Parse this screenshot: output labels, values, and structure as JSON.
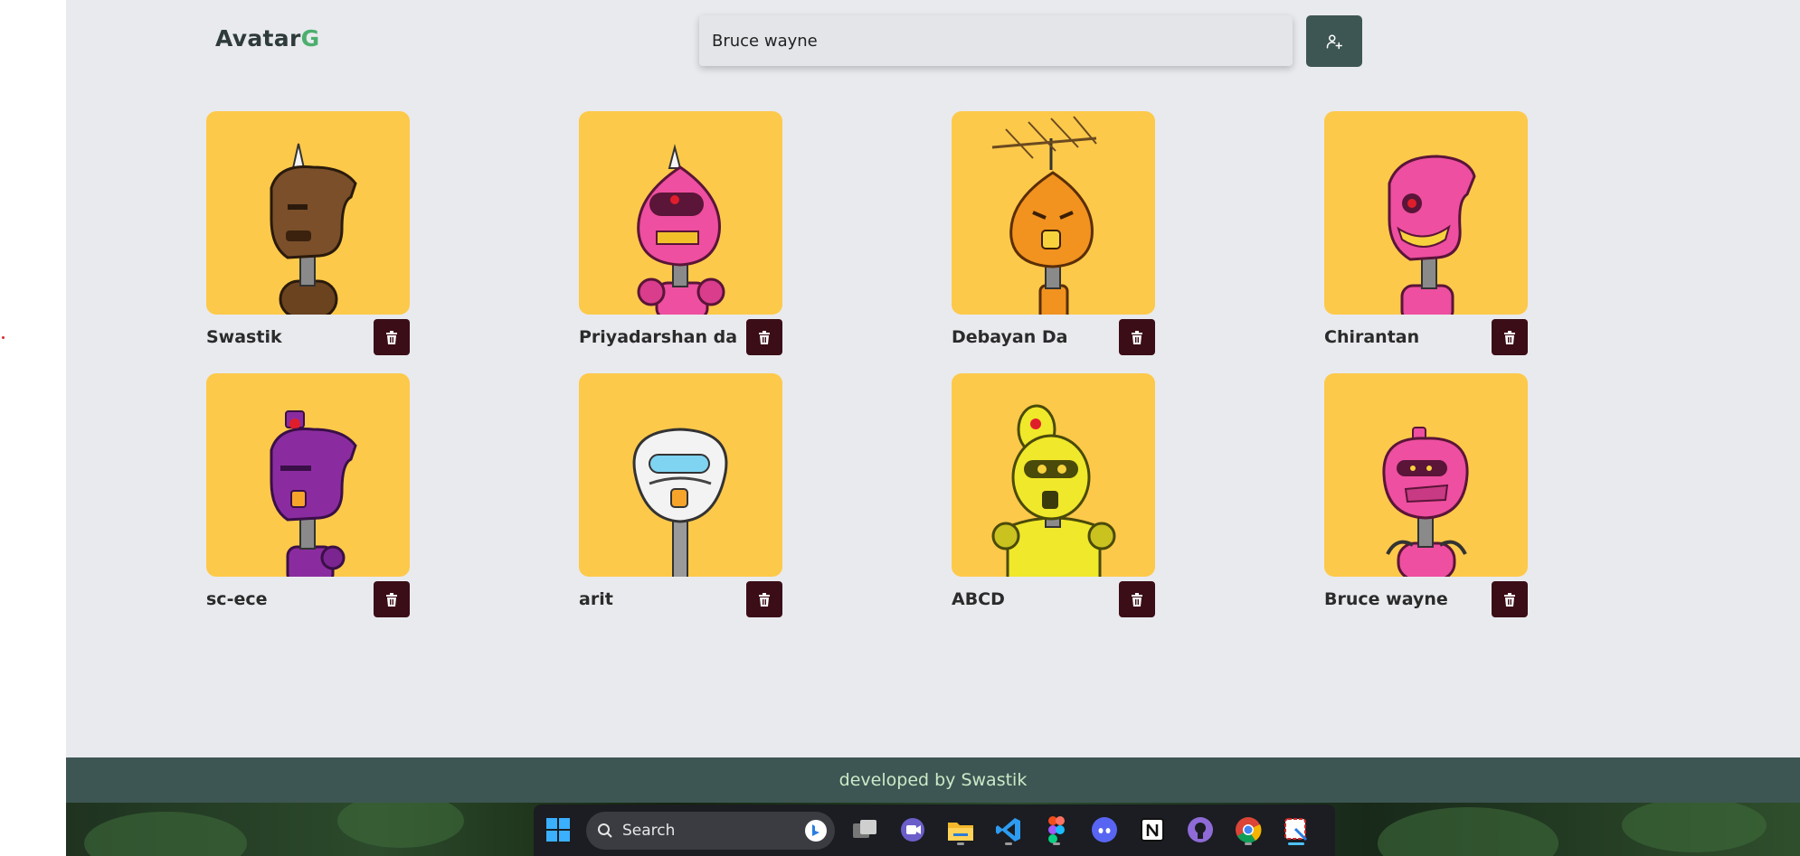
{
  "app": {
    "logo_main": "Avatar",
    "logo_accent": "G",
    "search_value": "Bruce wayne",
    "add_button_icon": "user-plus-icon",
    "delete_button_icon": "trash-icon"
  },
  "avatars": [
    {
      "name": "Swastik",
      "robot_color": "#7a4f2a"
    },
    {
      "name": "Priyadarshan da",
      "robot_color": "#ee4fa0"
    },
    {
      "name": "Debayan Da",
      "robot_color": "#f2921f"
    },
    {
      "name": "Chirantan",
      "robot_color": "#ee4fa0"
    },
    {
      "name": "sc-ece",
      "robot_color": "#8a2ca0"
    },
    {
      "name": "arit",
      "robot_color": "#f1f1f1"
    },
    {
      "name": "ABCD",
      "robot_color": "#f0e82a"
    },
    {
      "name": "Bruce wayne",
      "robot_color": "#ee4fa0"
    }
  ],
  "footer": {
    "text": "developed by Swastik"
  },
  "taskbar": {
    "search_label": "Search",
    "items": [
      "windows-start-icon",
      "search-box",
      "task-view-icon",
      "teams-chat-icon",
      "file-explorer-icon",
      "vscode-icon",
      "figma-icon",
      "discord-icon",
      "notion-icon",
      "github-icon",
      "chrome-icon",
      "snipping-tool-icon"
    ]
  },
  "colors": {
    "accent": "#3d5653",
    "card_bg": "#fdc94a",
    "delete_bg": "#3b0d17",
    "logo_accent": "#4caf6e"
  }
}
